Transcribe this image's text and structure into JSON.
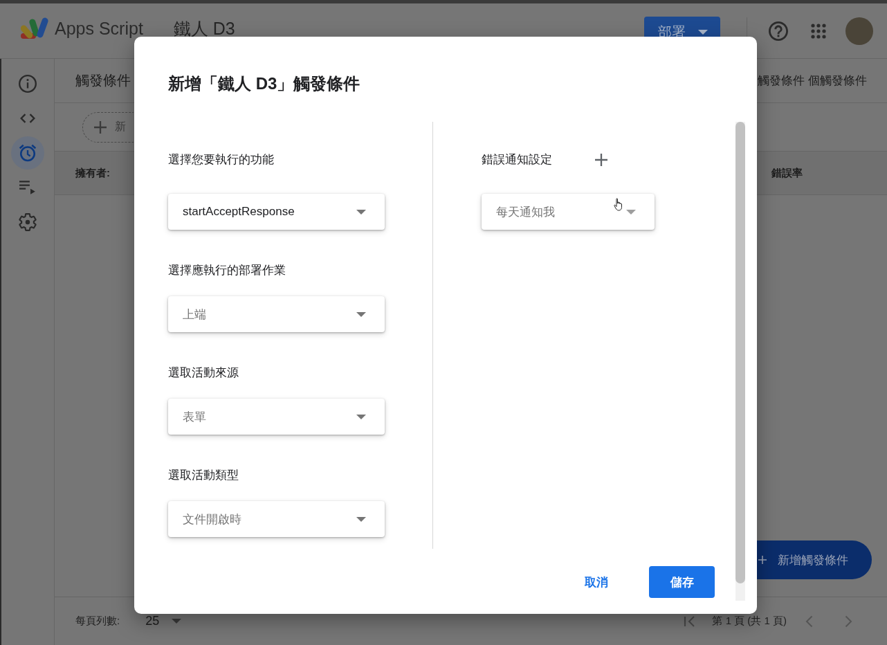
{
  "top_bar": {
    "app_name": "Apps Script",
    "project_title": "鐵人 D3",
    "deploy_button": "部署"
  },
  "sidebar": {
    "items": [
      {
        "kind": "info",
        "selected": false
      },
      {
        "kind": "code",
        "selected": false
      },
      {
        "kind": "triggers",
        "selected": true
      },
      {
        "kind": "executions",
        "selected": false
      },
      {
        "kind": "settings",
        "selected": false
      }
    ]
  },
  "triggers_page": {
    "title": "觸發條件",
    "summary": "觸發條件 個觸發條件",
    "add_button": "新",
    "columns": [
      "擁有者:",
      "錯誤率"
    ],
    "fab_button": "新增觸發條件"
  },
  "pagination": {
    "rows_per_page_label": "每頁列數:",
    "rows_per_page": "25",
    "page_info": "第 1 頁 (共 1 頁)"
  },
  "dialog": {
    "title": "新增「鐵人 D3」觸發條件",
    "fields": [
      {
        "label": "選擇您要執行的功能",
        "value": "startAcceptResponse",
        "focused": true
      },
      {
        "label": "選擇應執行的部署作業",
        "value": "上端",
        "focused": false
      },
      {
        "label": "選取活動來源",
        "value": "表單",
        "focused": false
      },
      {
        "label": "選取活動類型",
        "value": "文件開啟時",
        "focused": false
      }
    ],
    "error_notification": {
      "label": "錯誤通知設定",
      "value": "每天通知我",
      "focused": false
    },
    "buttons": [
      {
        "label": "取消",
        "kind": "text"
      },
      {
        "label": "儲存",
        "kind": "filled"
      }
    ]
  }
}
